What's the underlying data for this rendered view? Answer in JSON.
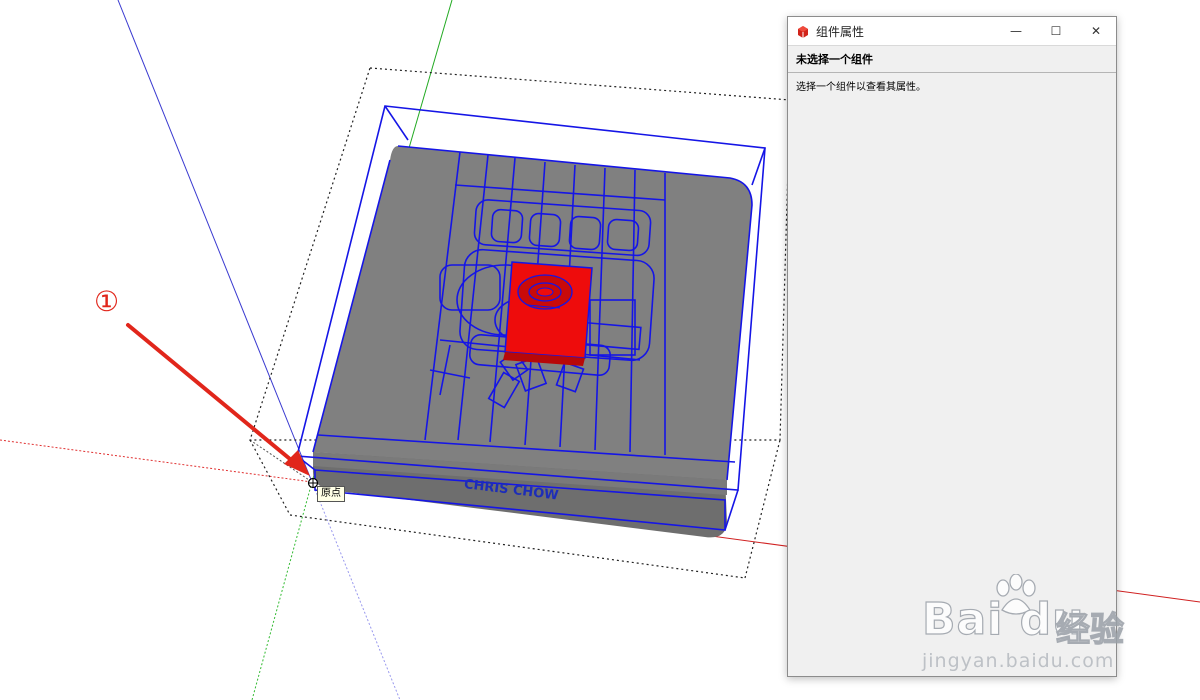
{
  "viewport": {
    "origin_tooltip": "原点",
    "step_marker": "①",
    "model_label": "CHRIS CHOW",
    "colors": {
      "selection_edges": "#1515e6",
      "model_body": "#767676",
      "selected_component": "#ee0c0c",
      "annotation_arrow": "#e1261b"
    }
  },
  "dialog": {
    "title": "组件属性",
    "app_icon": "sketchup-icon",
    "buttons": {
      "minimize": "—",
      "maximize": "☐",
      "close": "✕"
    },
    "header": "未选择一个组件",
    "message": "选择一个组件以查看其属性。"
  },
  "watermark": {
    "brand": "Bai du",
    "chinese": "经验",
    "url": "jingyan.baidu.com"
  }
}
